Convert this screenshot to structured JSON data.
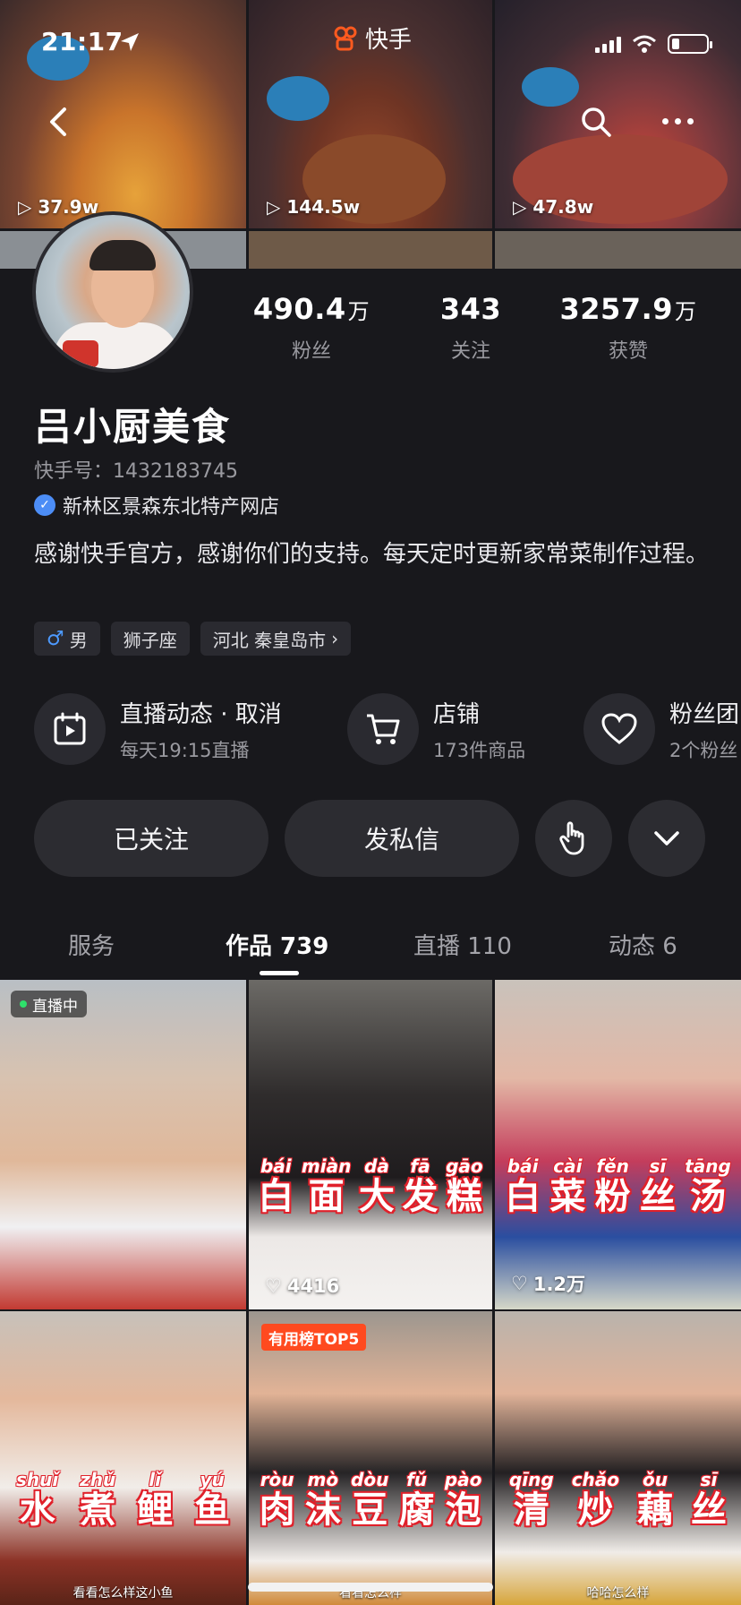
{
  "status_bar": {
    "time": "21:17"
  },
  "app": {
    "brand_name": "快手"
  },
  "banner": {
    "videos": [
      {
        "plays": "37.9w"
      },
      {
        "plays": "144.5w"
      },
      {
        "plays": "47.8w"
      }
    ]
  },
  "profile": {
    "name": "吕小厨美食",
    "account_id": "快手号：1432183745",
    "shop_name": "新林区景森东北特产网店",
    "bio": "感谢快手官方，感谢你们的支持。每天定时更新家常菜制作过程。",
    "stats": {
      "fans": {
        "value": "490.4",
        "unit": "万",
        "label": "粉丝"
      },
      "following": {
        "value": "343",
        "label": "关注"
      },
      "likes": {
        "value": "3257.9",
        "unit": "万",
        "label": "获赞"
      }
    },
    "tags": {
      "gender": "男",
      "zodiac": "狮子座",
      "location": "河北 秦皇岛市"
    }
  },
  "entries": {
    "live": {
      "title": "直播动态 · 取消",
      "subtitle": "每天19:15直播"
    },
    "shop": {
      "title": "店铺",
      "subtitle": "173件商品"
    },
    "fans": {
      "title": "粉丝团",
      "subtitle": "2个粉丝"
    }
  },
  "actions": {
    "following": "已关注",
    "message": "发私信"
  },
  "tabs": {
    "service": "服务",
    "works": "作品 739",
    "live": "直播 110",
    "moments": "动态 6"
  },
  "videos": {
    "v1": {
      "badge": "直播中"
    },
    "v2": {
      "likes": "4416",
      "caption": [
        [
          "bái",
          "白"
        ],
        [
          "miàn",
          "面"
        ],
        [
          "dà",
          "大"
        ],
        [
          "fā",
          "发"
        ],
        [
          "gāo",
          "糕"
        ]
      ]
    },
    "v3": {
      "likes": "1.2万",
      "caption": [
        [
          "bái",
          "白"
        ],
        [
          "cài",
          "菜"
        ],
        [
          "fěn",
          "粉"
        ],
        [
          "sī",
          "丝"
        ],
        [
          "tāng",
          "汤"
        ]
      ]
    },
    "v4": {
      "caption": [
        [
          "shuǐ",
          "水"
        ],
        [
          "zhǔ",
          "煮"
        ],
        [
          "lǐ",
          "鲤"
        ],
        [
          "yú",
          "鱼"
        ]
      ],
      "subtitle": "看看怎么样这小鱼"
    },
    "v5": {
      "badge": "有用榜TOP5",
      "caption": [
        [
          "ròu",
          "肉"
        ],
        [
          "mò",
          "沫"
        ],
        [
          "dòu",
          "豆"
        ],
        [
          "fǔ",
          "腐"
        ],
        [
          "pào",
          "泡"
        ]
      ],
      "subtitle": "看看怎么样"
    },
    "v6": {
      "caption": [
        [
          "qīng",
          "清"
        ],
        [
          "chǎo",
          "炒"
        ],
        [
          "ǒu",
          "藕"
        ],
        [
          "sī",
          "丝"
        ]
      ],
      "subtitle": "哈哈怎么样"
    }
  },
  "colors": {
    "background": "#18181c",
    "chip": "#2a2a30",
    "verify_blue": "#4c8df6",
    "live_green": "#2ee06b",
    "top_badge": "#ff4a1f",
    "caption_red": "#e0202a"
  }
}
